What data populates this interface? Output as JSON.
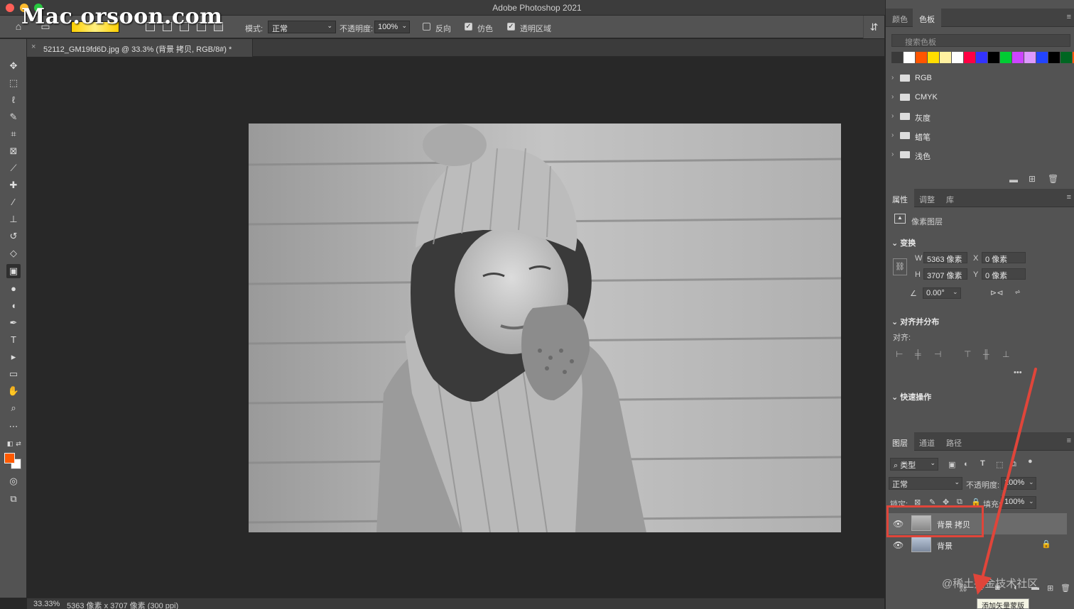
{
  "app": {
    "title": "Adobe Photoshop 2021",
    "watermark": "Mac.orsoon.com"
  },
  "options": {
    "mode_label": "模式:",
    "mode_value": "正常",
    "opacity_label": "不透明度:",
    "opacity_value": "100%",
    "reverse_label": "反向",
    "reverse_checked": false,
    "dither_label": "仿色",
    "dither_checked": true,
    "transparency_label": "透明区域",
    "transparency_checked": true
  },
  "document": {
    "tab_title": "52112_GM19fd6D.jpg @ 33.3% (背景 拷贝, RGB/8#) *"
  },
  "status": {
    "zoom": "33.33%",
    "info": "5363 像素 x 3707 像素 (300 ppi)"
  },
  "swatches": {
    "tabs": [
      "颜色",
      "色板"
    ],
    "active_tab": "色板",
    "search_placeholder": "搜索色板",
    "colors": [
      "#3a3a3a",
      "#ffffff",
      "#ff5500",
      "#ffdd00",
      "#fff1a0",
      "#ffffff",
      "#ff0044",
      "#3333ff",
      "#000000",
      "#00cc33",
      "#cc44ff",
      "#dd99ff",
      "#2244ff",
      "#000000",
      "#006622",
      "#ff5500"
    ],
    "folders": [
      "RGB",
      "CMYK",
      "灰度",
      "蜡笔",
      "浅色"
    ]
  },
  "properties": {
    "tabs": [
      "属性",
      "调整",
      "库"
    ],
    "active_tab": "属性",
    "layer_type": "像素图层",
    "transform_title": "变换",
    "w_label": "W",
    "w_value": "5363 像素",
    "h_label": "H",
    "h_value": "3707 像素",
    "x_label": "X",
    "x_value": "0 像素",
    "y_label": "Y",
    "y_value": "0 像素",
    "angle_value": "0.00°",
    "align_title": "对齐并分布",
    "align_label": "对齐:",
    "quick_title": "快速操作"
  },
  "layers": {
    "tabs": [
      "图层",
      "通道",
      "路径"
    ],
    "active_tab": "图层",
    "filter_label": "类型",
    "blend_mode": "正常",
    "opacity_label": "不透明度:",
    "opacity_value": "100%",
    "lock_label": "锁定:",
    "fill_label": "填充:",
    "fill_value": "100%",
    "items": [
      {
        "name": "背景 拷贝",
        "visible": true,
        "locked": false,
        "selected": true
      },
      {
        "name": "背景",
        "visible": true,
        "locked": true,
        "selected": false
      }
    ],
    "tooltip": "添加矢量蒙版"
  },
  "watermark_bottom": "@稀土掘金技术社区",
  "tools": [
    "move-icon",
    "marquee-icon",
    "lasso-icon",
    "quick-select-icon",
    "crop-icon",
    "frame-icon",
    "eyedropper-icon",
    "healing-icon",
    "brush-icon",
    "stamp-icon",
    "history-brush-icon",
    "eraser-icon",
    "gradient-icon",
    "blur-icon",
    "dodge-icon",
    "pen-icon",
    "type-icon",
    "path-select-icon",
    "rectangle-icon",
    "hand-icon",
    "zoom-icon",
    "more-icon"
  ],
  "colors": {
    "foreground": "#ff5a00",
    "background": "#ffffff",
    "annotation": "#e0453a"
  }
}
